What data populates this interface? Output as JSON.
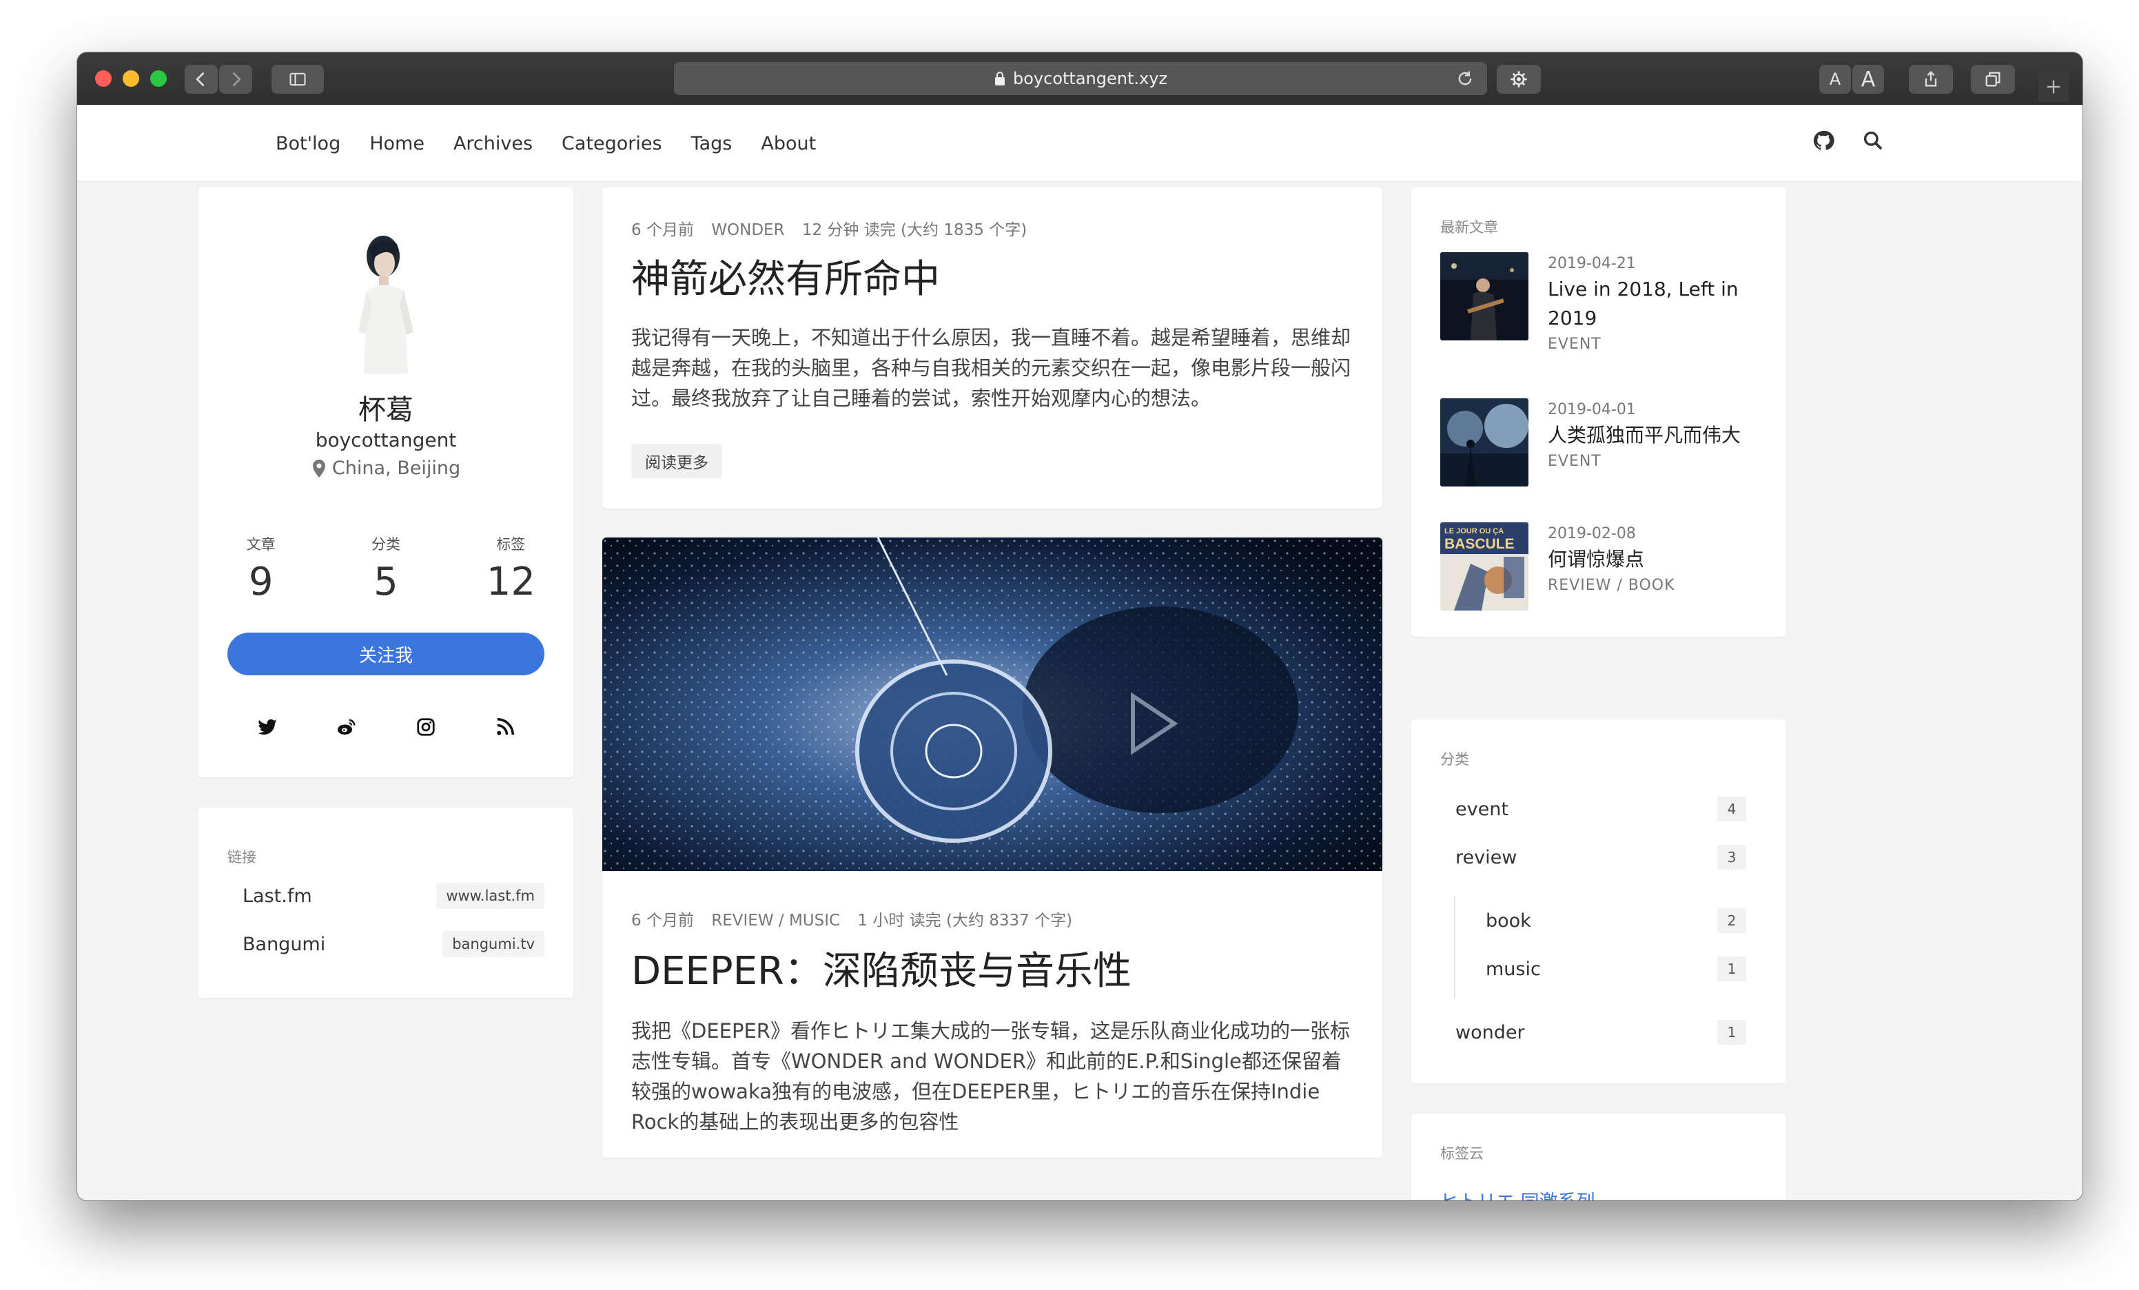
{
  "browser": {
    "url": "boycottangent.xyz",
    "font_small": "A",
    "font_large": "A"
  },
  "nav": {
    "brand": "Bot'log",
    "links": [
      "Home",
      "Archives",
      "Categories",
      "Tags",
      "About"
    ]
  },
  "profile": {
    "name": "杯葛",
    "username": "boycottangent",
    "location": "China, Beijing",
    "stats": [
      {
        "label": "文章",
        "value": "9"
      },
      {
        "label": "分类",
        "value": "5"
      },
      {
        "label": "标签",
        "value": "12"
      }
    ],
    "follow_label": "关注我",
    "socials": [
      "twitter-icon",
      "weibo-icon",
      "instagram-icon",
      "rss-icon"
    ]
  },
  "links": {
    "title": "链接",
    "items": [
      {
        "name": "Last.fm",
        "badge": "www.last.fm"
      },
      {
        "name": "Bangumi",
        "badge": "bangumi.tv"
      }
    ]
  },
  "posts": [
    {
      "time": "6 个月前",
      "category": "WONDER",
      "reading": "12 分钟 读完 (大约 1835 个字)",
      "title": "神箭必然有所命中",
      "excerpt": "我记得有一天晚上，不知道出于什么原因，我一直睡不着。越是希望睡着，思维却越是奔越，在我的头脑里，各种与自我相关的元素交织在一起，像电影片段一般闪过。最终我放弃了让自己睡着的尝试，索性开始观摩内心的想法。",
      "read_more": "阅读更多"
    },
    {
      "time": "6 个月前",
      "category": "REVIEW / MUSIC",
      "reading": "1 小时 读完 (大约 8337 个字)",
      "title": "DEEPER：深陷颓丧与音乐性",
      "excerpt": "我把《DEEPER》看作ヒトリエ集大成的一张专辑，这是乐队商业化成功的一张标志性专辑。首专《WONDER and WONDER》和此前的E.P.和Single都还保留着较强的wowaka独有的电波感，但在DEEPER里，ヒトリエ的音乐在保持Indie Rock的基础上的表现出更多的包容性"
    }
  ],
  "recent": {
    "title": "最新文章",
    "items": [
      {
        "date": "2019-04-21",
        "title": "Live in 2018, Left in 2019",
        "category": "EVENT"
      },
      {
        "date": "2019-04-01",
        "title": "人类孤独而平凡而伟大",
        "category": "EVENT"
      },
      {
        "date": "2019-02-08",
        "title": "何谓惊爆点",
        "category": "REVIEW / BOOK",
        "thumb_text_1": "LE JOUR OU ÇA",
        "thumb_text_2": "BASCULE"
      }
    ]
  },
  "categories": {
    "title": "分类",
    "items": [
      {
        "name": "event",
        "count": "4"
      },
      {
        "name": "review",
        "count": "3"
      },
      {
        "name": "book",
        "count": "2"
      },
      {
        "name": "music",
        "count": "1"
      },
      {
        "name": "wonder",
        "count": "1"
      }
    ]
  },
  "tagcloud": {
    "title": "标签云",
    "preview": "ヒトリエ    同激系列"
  },
  "colors": {
    "accent": "#3b76de",
    "titlebar": "#333333",
    "page_bg": "#f4f4f4"
  }
}
